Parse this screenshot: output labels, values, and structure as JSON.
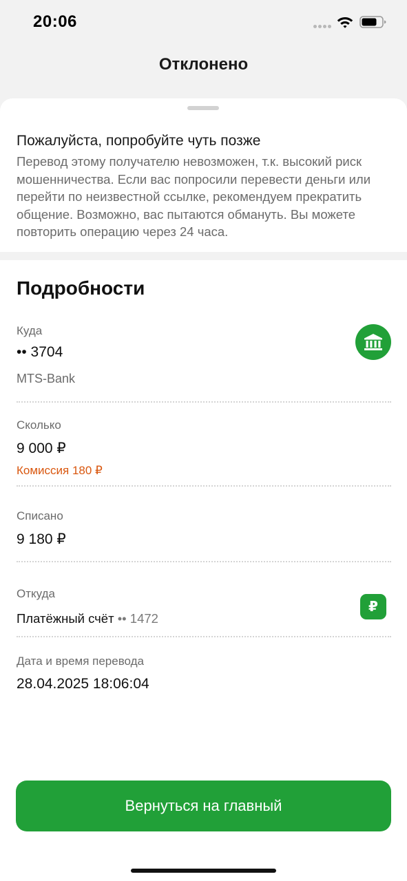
{
  "status_bar": {
    "time": "20:06"
  },
  "header": {
    "title": "Отклонено"
  },
  "warning": {
    "heading": "Пожалуйста, попробуйте чуть позже",
    "text": "Перевод этому получателю невозможен, т.к. высокий риск мошенничества. Если вас попросили перевести деньги или перейти по неизвестной ссылке, рекомендуем прекратить общение. Возможно, вас пытаются обмануть. Вы можете повторить операцию через 24 часа."
  },
  "details": {
    "title": "Подробности",
    "to": {
      "label": "Куда",
      "value": "•• 3704",
      "bank": "MTS-Bank",
      "icon": "bank-icon"
    },
    "amount": {
      "label": "Сколько",
      "value": "9 000 ₽",
      "commission": "Комиссия 180 ₽"
    },
    "debited": {
      "label": "Списано",
      "value": "9 180 ₽"
    },
    "from": {
      "label": "Откуда",
      "account": "Платёжный счёт",
      "masked": "•• 1472",
      "icon": "ruble-icon",
      "icon_glyph": "₽"
    },
    "datetime": {
      "label": "Дата и время перевода",
      "value": "28.04.2025 18:06:04"
    }
  },
  "footer": {
    "button_label": "Вернуться на главный"
  },
  "colors": {
    "accent": "#21a038",
    "commission": "#d9570f",
    "text_secondary": "#6b6b6b"
  }
}
